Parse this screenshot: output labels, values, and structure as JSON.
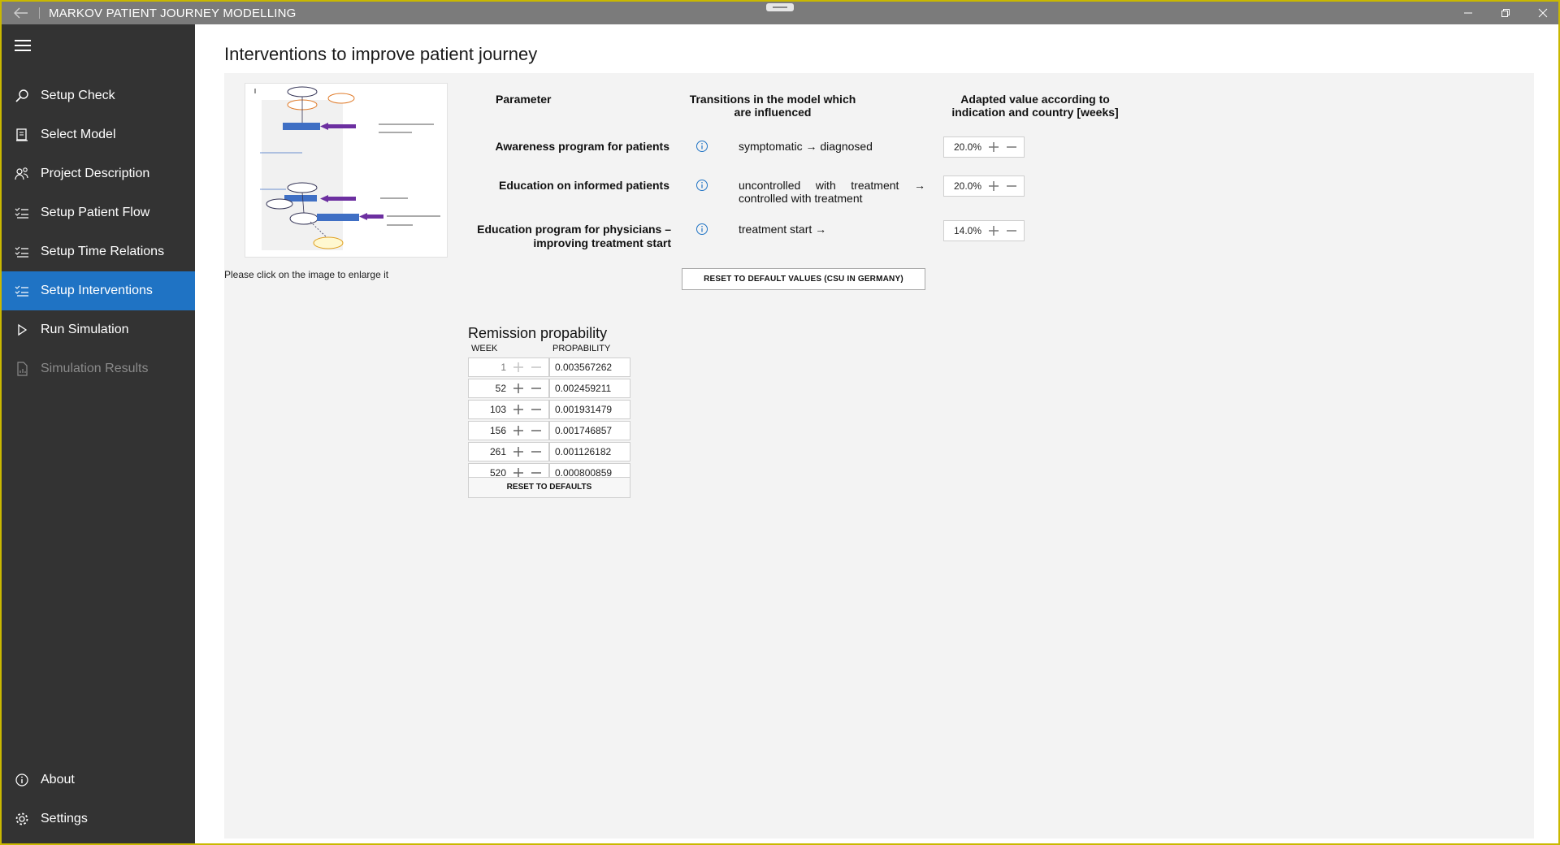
{
  "window": {
    "title": "MARKOV PATIENT JOURNEY MODELLING"
  },
  "sidebar": {
    "items": [
      {
        "label": "Setup Check",
        "icon": "search-icon"
      },
      {
        "label": "Select Model",
        "icon": "model-icon"
      },
      {
        "label": "Project Description",
        "icon": "people-icon"
      },
      {
        "label": "Setup Patient Flow",
        "icon": "checklist-icon"
      },
      {
        "label": "Setup Time Relations",
        "icon": "checklist-icon"
      },
      {
        "label": "Setup Interventions",
        "icon": "checklist-icon",
        "active": true
      },
      {
        "label": "Run Simulation",
        "icon": "play-icon"
      },
      {
        "label": "Simulation Results",
        "icon": "report-icon",
        "disabled": true
      }
    ],
    "bottom": [
      {
        "label": "About",
        "icon": "info-icon"
      },
      {
        "label": "Settings",
        "icon": "gear-icon"
      }
    ]
  },
  "page": {
    "title": "Interventions to improve patient journey",
    "image_caption": "Please click on the image to enlarge it",
    "headers": {
      "parameter": "Parameter",
      "transitions": "Transitions in the model which are influenced",
      "adapted": "Adapted value according to indication and country [weeks]"
    },
    "interventions": [
      {
        "parameter": "Awareness program for patients",
        "transition": "symptomatic → diagnosed",
        "value": "20.0%"
      },
      {
        "parameter": "Education on informed patients",
        "transition": "uncontrolled with treatment → controlled with treatment",
        "value": "20.0%"
      },
      {
        "parameter": "Education program for physicians – improving treatment start",
        "transition": "treatment start →",
        "value": "14.0%"
      }
    ],
    "reset_button": "RESET TO DEFAULT VALUES (CSU IN GERMANY)"
  },
  "remission": {
    "title": "Remission propability",
    "col_week": "WEEK",
    "col_prob": "PROPABILITY",
    "rows": [
      {
        "week": "1",
        "prob": "0.003567262"
      },
      {
        "week": "52",
        "prob": "0.002459211"
      },
      {
        "week": "103",
        "prob": "0.001931479"
      },
      {
        "week": "156",
        "prob": "0.001746857"
      },
      {
        "week": "261",
        "prob": "0.001126182"
      },
      {
        "week": "520",
        "prob": "0.000800859"
      }
    ],
    "reset": "RESET TO DEFAULTS"
  }
}
